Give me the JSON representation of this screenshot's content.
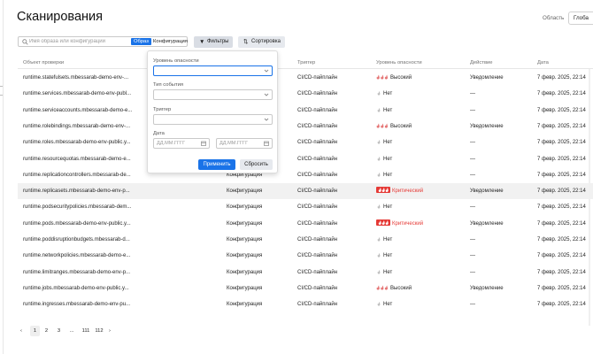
{
  "page": {
    "title": "Сканирования"
  },
  "scope": {
    "label": "Область",
    "value": "Глоба"
  },
  "search": {
    "placeholder": "Имя образа или конфигурации",
    "value": "",
    "mode_image": "Образ",
    "mode_config": "Конфигурация"
  },
  "toolbar": {
    "filters_label": "Фильтры",
    "sort_label": "Сортировка"
  },
  "table": {
    "headers": [
      "Объект проверки",
      "",
      "Триггер",
      "Уровень опасности",
      "Действие",
      "Дата"
    ],
    "rows": [
      {
        "object": "runtime.statefulsets.mbessarab-demo-env-...",
        "type": "",
        "trigger": "CI/CD-пайплайн",
        "severity": "Высокий",
        "level": "high",
        "action": "Уведомление",
        "date": "7 февр. 2025, 22:14",
        "highlight": false
      },
      {
        "object": "runtime.services.mbessarab-demo-env-publ...",
        "type": "",
        "trigger": "CI/CD-пайплайн",
        "severity": "Нет",
        "level": "none",
        "action": "—",
        "date": "7 февр. 2025, 22:14",
        "highlight": false
      },
      {
        "object": "runtime.serviceaccounts.mbessarab-demo-e...",
        "type": "",
        "trigger": "CI/CD-пайплайн",
        "severity": "Нет",
        "level": "none",
        "action": "—",
        "date": "7 февр. 2025, 22:14",
        "highlight": false
      },
      {
        "object": "runtime.rolebindings.mbessarab-demo-env-...",
        "type": "",
        "trigger": "CI/CD-пайплайн",
        "severity": "Высокий",
        "level": "high",
        "action": "Уведомление",
        "date": "7 февр. 2025, 22:14",
        "highlight": false
      },
      {
        "object": "runtime.roles.mbessarab-demo-env-public.y...",
        "type": "",
        "trigger": "CI/CD-пайплайн",
        "severity": "Нет",
        "level": "none",
        "action": "—",
        "date": "7 февр. 2025, 22:14",
        "highlight": false
      },
      {
        "object": "runtime.resourcequotas.mbessarab-demo-e...",
        "type": "",
        "trigger": "CI/CD-пайплайн",
        "severity": "Нет",
        "level": "none",
        "action": "—",
        "date": "7 февр. 2025, 22:14",
        "highlight": false
      },
      {
        "object": "runtime.replicationcontrollers.mbessarab-de...",
        "type": "Конфигурация",
        "trigger": "CI/CD-пайплайн",
        "severity": "Нет",
        "level": "none",
        "action": "—",
        "date": "7 февр. 2025, 22:14",
        "highlight": false
      },
      {
        "object": "runtime.replicasets.mbessarab-demo-env-p...",
        "type": "Конфигурация",
        "trigger": "CI/CD-пайплайн",
        "severity": "Критический",
        "level": "critical",
        "action": "Уведомление",
        "date": "7 февр. 2025, 22:14",
        "highlight": true
      },
      {
        "object": "runtime.podsecuritypolicies.mbessarab-dem...",
        "type": "Конфигурация",
        "trigger": "CI/CD-пайплайн",
        "severity": "Нет",
        "level": "none",
        "action": "—",
        "date": "7 февр. 2025, 22:14",
        "highlight": false
      },
      {
        "object": "runtime.pods.mbessarab-demo-env-public.y...",
        "type": "Конфигурация",
        "trigger": "CI/CD-пайплайн",
        "severity": "Критический",
        "level": "critical",
        "action": "Уведомление",
        "date": "7 февр. 2025, 22:14",
        "highlight": false
      },
      {
        "object": "runtime.poddisruptionbudgets.mbessarab-d...",
        "type": "Конфигурация",
        "trigger": "CI/CD-пайплайн",
        "severity": "Нет",
        "level": "none",
        "action": "—",
        "date": "7 февр. 2025, 22:14",
        "highlight": false
      },
      {
        "object": "runtime.networkpolicies.mbessarab-demo-e...",
        "type": "Конфигурация",
        "trigger": "CI/CD-пайплайн",
        "severity": "Нет",
        "level": "none",
        "action": "—",
        "date": "7 февр. 2025, 22:14",
        "highlight": false
      },
      {
        "object": "runtime.limitranges.mbessarab-demo-env-p...",
        "type": "Конфигурация",
        "trigger": "CI/CD-пайплайн",
        "severity": "Нет",
        "level": "none",
        "action": "—",
        "date": "7 февр. 2025, 22:14",
        "highlight": false
      },
      {
        "object": "runtime.jobs.mbessarab-demo-env-public.y...",
        "type": "Конфигурация",
        "trigger": "CI/CD-пайплайн",
        "severity": "Высокий",
        "level": "high",
        "action": "Уведомление",
        "date": "7 февр. 2025, 22:14",
        "highlight": false
      },
      {
        "object": "runtime.ingresses.mbessarab-demo-env-pu...",
        "type": "Конфигурация",
        "trigger": "CI/CD-пайплайн",
        "severity": "Нет",
        "level": "none",
        "action": "—",
        "date": "7 февр. 2025, 22:14",
        "highlight": false
      }
    ]
  },
  "pagination": {
    "prev": "‹",
    "pages": [
      "1",
      "2",
      "3",
      "...",
      "111",
      "112"
    ],
    "current": "1",
    "next": "›"
  },
  "filter_panel": {
    "severity_label": "Уровень опасности",
    "severity_value": "",
    "event_type_label": "Тип события",
    "event_type_value": "",
    "trigger_label": "Триггер",
    "trigger_value": "",
    "date_label": "Дата",
    "date_from_placeholder": "ДД.ММ.ГГГГ",
    "date_to_placeholder": "ДД.ММ.ГГГГ",
    "apply_label": "Применить",
    "reset_label": "Сбросить"
  },
  "colors": {
    "accent": "#1a73e8",
    "critical": "#e53935",
    "high": "#e57373",
    "none": "#bdbdbd"
  },
  "icons": {
    "search": "search-icon",
    "filter": "filter-icon",
    "sort": "sort-icon",
    "calendar": "calendar-icon",
    "chevron": "chevron-down-icon",
    "severity": "severity-flames-icon"
  }
}
